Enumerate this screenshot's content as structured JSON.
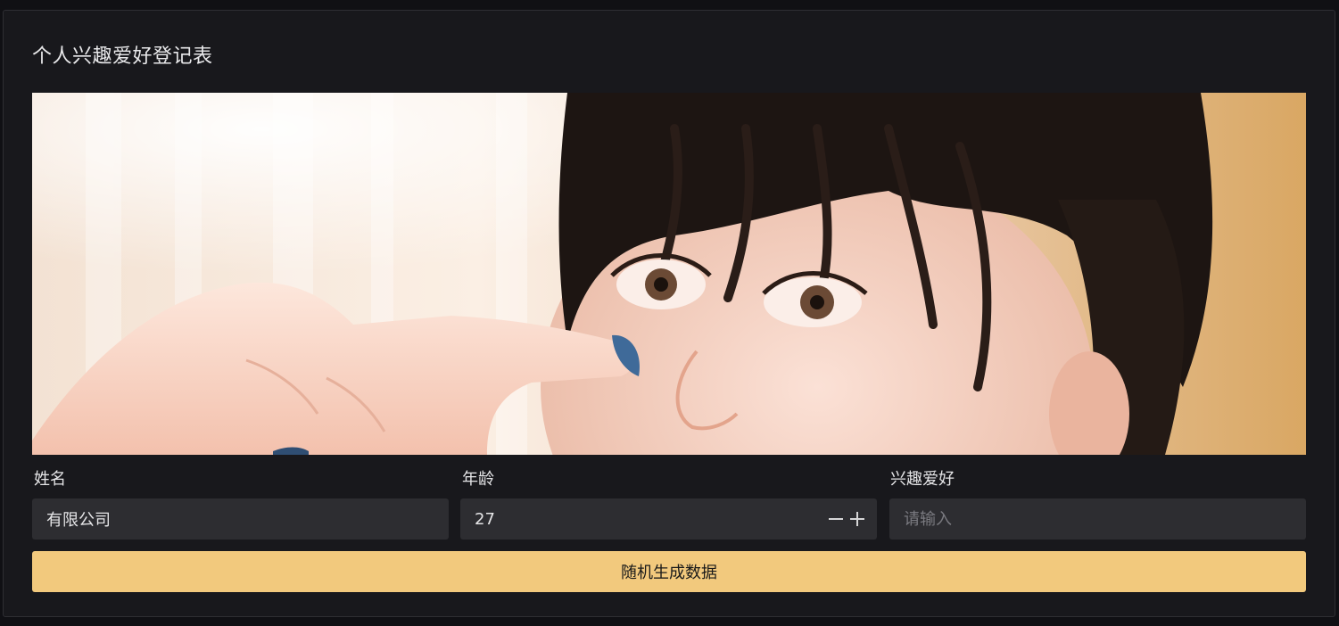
{
  "form": {
    "title": "个人兴趣爱好登记表",
    "banner_image": "portrait-photo",
    "fields": {
      "name": {
        "label": "姓名",
        "value": "有限公司"
      },
      "age": {
        "label": "年龄",
        "value": "27"
      },
      "hobby": {
        "label": "兴趣爱好",
        "placeholder": "请输入",
        "value": ""
      }
    },
    "generate_button": "随机生成数据"
  },
  "colors": {
    "background": "#101014",
    "card": "#18181c",
    "input": "#2d2d31",
    "accent": "#f2c97d"
  }
}
